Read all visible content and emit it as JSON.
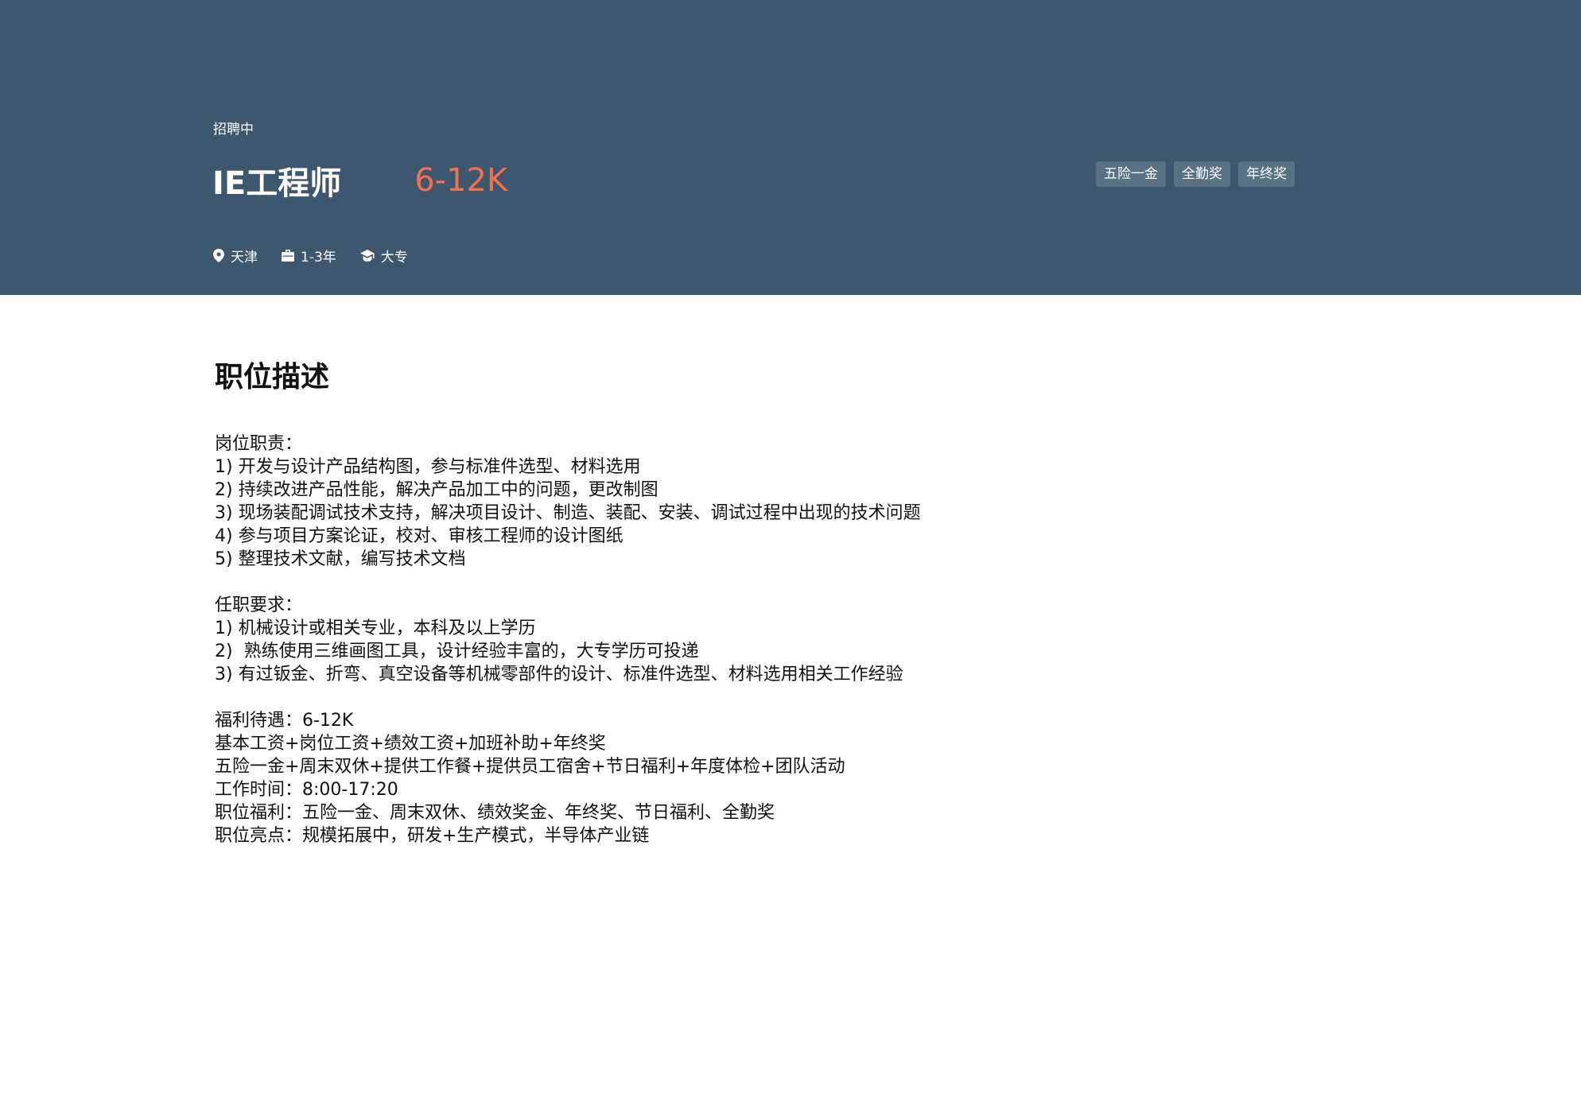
{
  "header": {
    "status": "招聘中",
    "title": "IE工程师",
    "salary": "6-12K",
    "tags": [
      "五险一金",
      "全勤奖",
      "年终奖"
    ],
    "meta": {
      "location": "天津",
      "experience": "1-3年",
      "education": "大专"
    },
    "colors": {
      "background": "#3c576e",
      "salary": "#f2704a",
      "tag_background": "#587183"
    }
  },
  "description": {
    "title": "职位描述",
    "lines": [
      "岗位职责：",
      "1) 开发与设计产品结构图，参与标准件选型、材料选用",
      "2) 持续改进产品性能，解决产品加工中的问题，更改制图",
      "3) 现场装配调试技术支持，解决项目设计、制造、装配、安装、调试过程中出现的技术问题",
      "4) 参与项目方案论证，校对、审核工程师的设计图纸",
      "5) 整理技术文献，编写技术文档",
      "",
      "任职要求：",
      "1) 机械设计或相关专业，本科及以上学历",
      "2)  熟练使用三维画图工具，设计经验丰富的，大专学历可投递",
      "3) 有过钣金、折弯、真空设备等机械零部件的设计、标准件选型、材料选用相关工作经验",
      "",
      "福利待遇：6-12K",
      "基本工资+岗位工资+绩效工资+加班补助+年终奖",
      "五险一金+周末双休+提供工作餐+提供员工宿舍+节日福利+年度体检+团队活动",
      "工作时间：8:00-17:20",
      "职位福利：五险一金、周末双休、绩效奖金、年终奖、节日福利、全勤奖",
      "职位亮点：规模拓展中，研发+生产模式，半导体产业链"
    ]
  }
}
